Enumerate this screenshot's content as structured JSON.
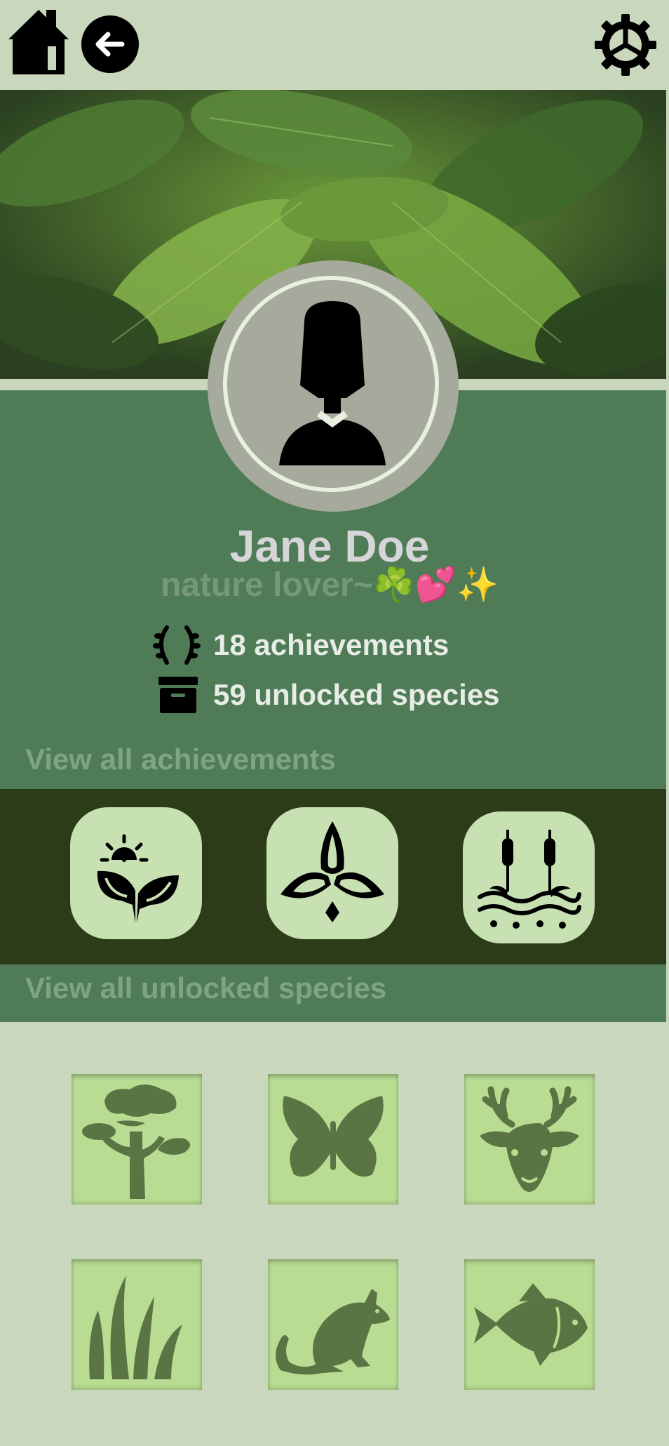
{
  "profile": {
    "name": "Jane Doe",
    "tagline": "nature lover~☘️💕✨"
  },
  "stats": {
    "achievements": "18 achievements",
    "species": "59 unlocked species"
  },
  "links": {
    "achievements": "View all achievements",
    "species": "View all unlocked species"
  },
  "achievement_badges": [
    "sun-plant-icon",
    "trillium-flower-icon",
    "wetland-cattail-icon"
  ],
  "species_tiles": [
    "tree-icon",
    "butterfly-icon",
    "deer-icon",
    "grass-icon",
    "rat-icon",
    "fish-icon"
  ],
  "colors": {
    "page_bg": "#c9d8bd",
    "profile_green": "#4f7c57",
    "achievement_strip": "#2d3c18",
    "badge_bg": "#c7e1b3",
    "tile_bg": "#b8dd92",
    "tile_icon": "#5a7443"
  }
}
